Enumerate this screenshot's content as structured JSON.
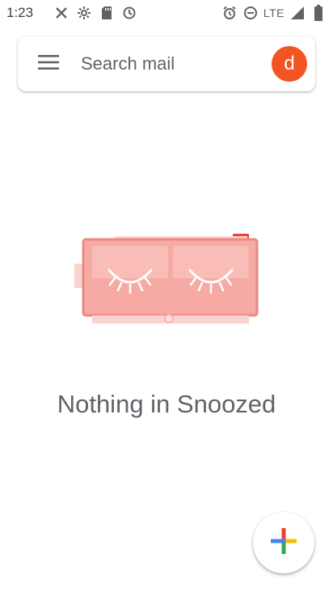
{
  "status_bar": {
    "time": "1:23",
    "network": "LTE",
    "left_icons": [
      "missed-call-x-icon",
      "settings-fan-icon",
      "sd-card-icon",
      "sync-icon"
    ],
    "right_icons": [
      "alarm-icon",
      "do-not-disturb-icon",
      "lte-signal-icon",
      "battery-icon"
    ]
  },
  "search_bar": {
    "placeholder": "Search mail",
    "menu_icon": "hamburger-menu-icon",
    "avatar_letter": "d",
    "avatar_color": "#f25522"
  },
  "empty_state": {
    "message": "Nothing in Snoozed",
    "illustration": "sleeping-alarm-clock-illustration",
    "accent_color": "#f28b82"
  },
  "compose": {
    "icon": "plus-icon"
  }
}
